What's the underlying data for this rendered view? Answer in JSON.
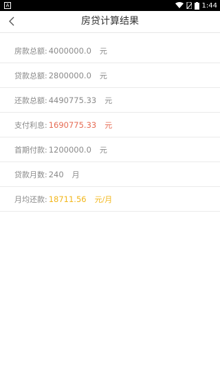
{
  "status_bar": {
    "time": "1:44",
    "left_icon": "app-notification-icon",
    "icons": [
      "wifi-icon",
      "sim-icon",
      "battery-icon"
    ]
  },
  "header": {
    "title": "房贷计算结果",
    "back_icon": "back-arrow-icon"
  },
  "rows": [
    {
      "label": "房款总额:",
      "value": "4000000.0",
      "unit": "元",
      "color": "#8a8a8a"
    },
    {
      "label": "贷款总额:",
      "value": "2800000.0",
      "unit": "元",
      "color": "#8a8a8a"
    },
    {
      "label": "还款总额:",
      "value": "4490775.33",
      "unit": "元",
      "color": "#8a8a8a"
    },
    {
      "label": "支付利息:",
      "value": "1690775.33",
      "unit": "元",
      "color": "#e66b53"
    },
    {
      "label": "首期付款:",
      "value": "1200000.0",
      "unit": "元",
      "color": "#8a8a8a"
    },
    {
      "label": "贷款月数:",
      "value": "240",
      "unit": "月",
      "color": "#8a8a8a"
    },
    {
      "label": "月均还款:",
      "value": "18711.56",
      "unit": "元/月",
      "color": "#f2b61a"
    }
  ]
}
